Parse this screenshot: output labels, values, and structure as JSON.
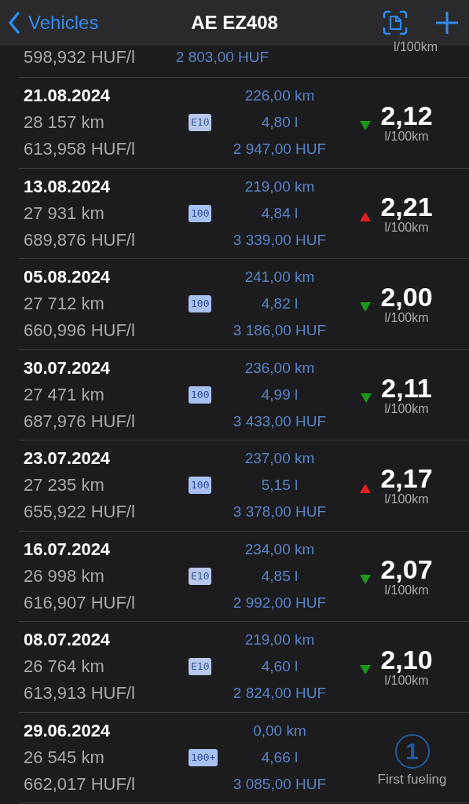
{
  "nav": {
    "back_label": "Vehicles",
    "title": "AE EZ408"
  },
  "partial_row": {
    "price_per_liter": "598,932 HUF/l",
    "cost": "2 803,00 HUF",
    "unit": "l/100km"
  },
  "entries": [
    {
      "date": "21.08.2024",
      "odometer": "28 157 km",
      "price_per_liter": "613,958 HUF/l",
      "fuel": "E10",
      "distance": "226,00 km",
      "volume": "4,80 l",
      "cost": "2 947,00 HUF",
      "kind": "down",
      "consumption": "2,12",
      "unit": "l/100km"
    },
    {
      "date": "13.08.2024",
      "odometer": "27 931 km",
      "price_per_liter": "689,876 HUF/l",
      "fuel": "100",
      "distance": "219,00 km",
      "volume": "4,84 l",
      "cost": "3 339,00 HUF",
      "kind": "up",
      "consumption": "2,21",
      "unit": "l/100km"
    },
    {
      "date": "05.08.2024",
      "odometer": "27 712 km",
      "price_per_liter": "660,996 HUF/l",
      "fuel": "100",
      "distance": "241,00 km",
      "volume": "4,82 l",
      "cost": "3 186,00 HUF",
      "kind": "down",
      "consumption": "2,00",
      "unit": "l/100km"
    },
    {
      "date": "30.07.2024",
      "odometer": "27 471 km",
      "price_per_liter": "687,976 HUF/l",
      "fuel": "100",
      "distance": "236,00 km",
      "volume": "4,99 l",
      "cost": "3 433,00 HUF",
      "kind": "down",
      "consumption": "2,11",
      "unit": "l/100km"
    },
    {
      "date": "23.07.2024",
      "odometer": "27 235 km",
      "price_per_liter": "655,922 HUF/l",
      "fuel": "100",
      "distance": "237,00 km",
      "volume": "5,15 l",
      "cost": "3 378,00 HUF",
      "kind": "up",
      "consumption": "2,17",
      "unit": "l/100km"
    },
    {
      "date": "16.07.2024",
      "odometer": "26 998 km",
      "price_per_liter": "616,907 HUF/l",
      "fuel": "E10",
      "distance": "234,00 km",
      "volume": "4,85 l",
      "cost": "2 992,00 HUF",
      "kind": "down",
      "consumption": "2,07",
      "unit": "l/100km"
    },
    {
      "date": "08.07.2024",
      "odometer": "26 764 km",
      "price_per_liter": "613,913 HUF/l",
      "fuel": "E10",
      "distance": "219,00 km",
      "volume": "4,60 l",
      "cost": "2 824,00 HUF",
      "kind": "down",
      "consumption": "2,10",
      "unit": "l/100km"
    },
    {
      "date": "29.06.2024",
      "odometer": "26 545 km",
      "price_per_liter": "662,017 HUF/l",
      "fuel": "100+",
      "distance": "0,00 km",
      "volume": "4,66 l",
      "cost": "3 085,00 HUF",
      "kind": "first",
      "consumption": "1",
      "unit": "First fueling"
    }
  ]
}
